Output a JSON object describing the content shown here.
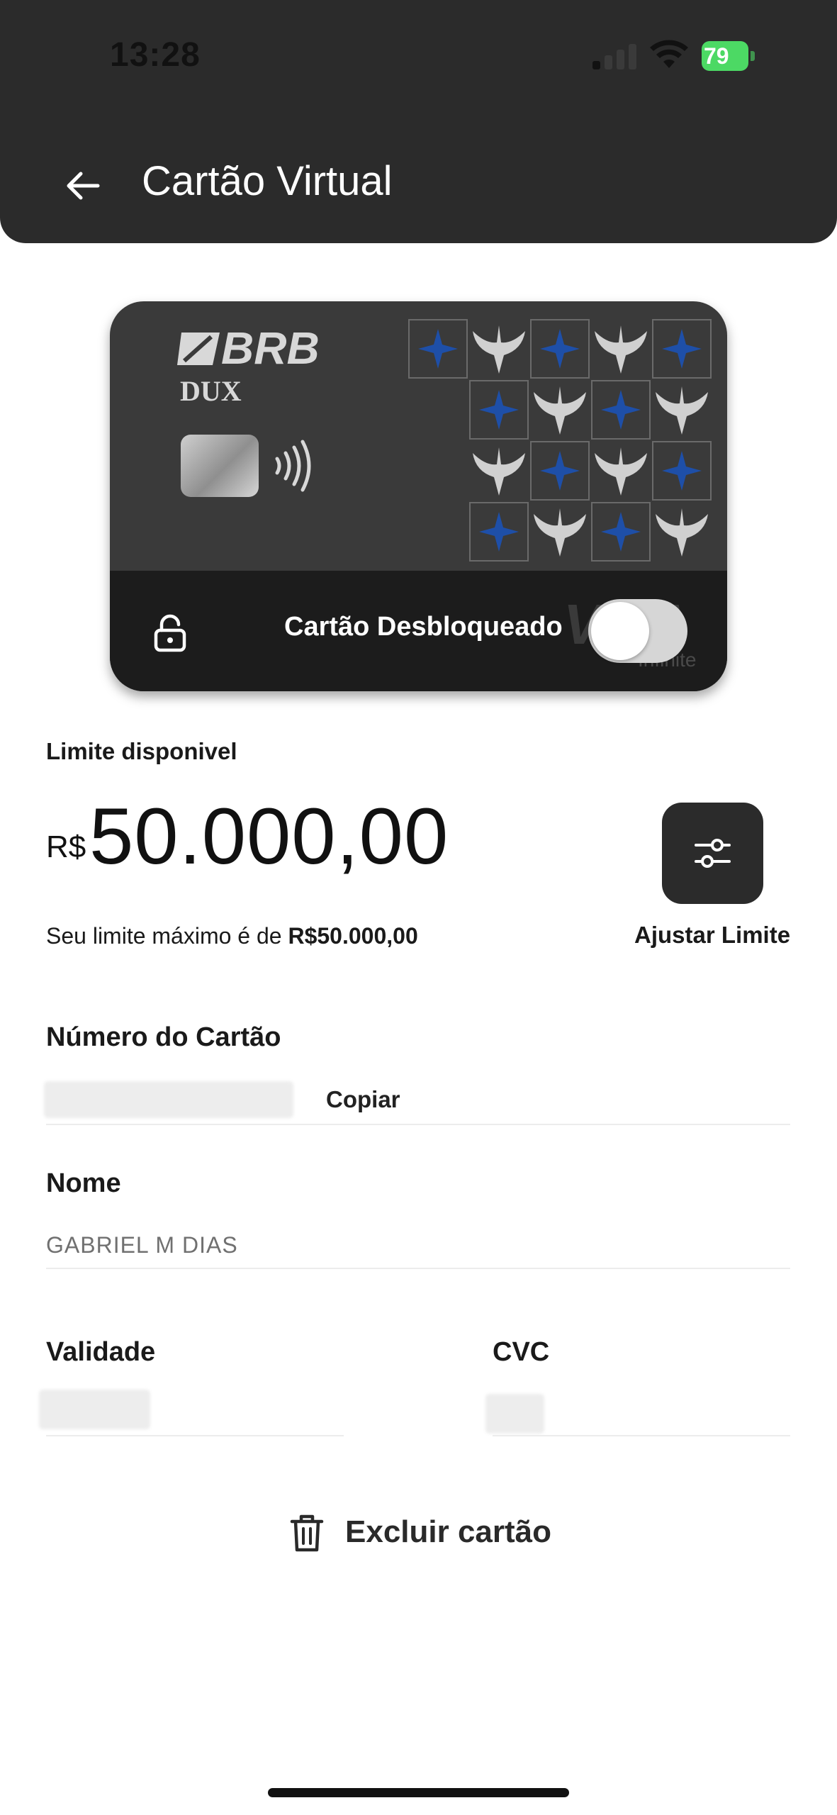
{
  "status_bar": {
    "time": "13:28",
    "battery": "79"
  },
  "header": {
    "title": "Cartão Virtual"
  },
  "card": {
    "brand": "BRB",
    "product": "DUX",
    "status": "Cartão Desbloqueado",
    "network": "VISA",
    "network_sub": "Infinite",
    "unlocked": true
  },
  "limit": {
    "label": "Limite disponivel",
    "currency": "R$",
    "value": "50.000,00",
    "max_prefix": "Seu limite máximo é de ",
    "max_value": "R$50.000,00",
    "adjust_label": "Ajustar Limite"
  },
  "fields": {
    "card_number_label": "Número do Cartão",
    "copy_label": "Copiar",
    "name_label": "Nome",
    "name_value": "GABRIEL M DIAS",
    "validity_label": "Validade",
    "cvc_label": "CVC"
  },
  "actions": {
    "delete_label": "Excluir cartão"
  },
  "colors": {
    "header_bg": "#2b2b2b",
    "card_bg": "#3a3a3a",
    "accent_blue": "#1e4fa8",
    "battery_green": "#4cd964"
  }
}
